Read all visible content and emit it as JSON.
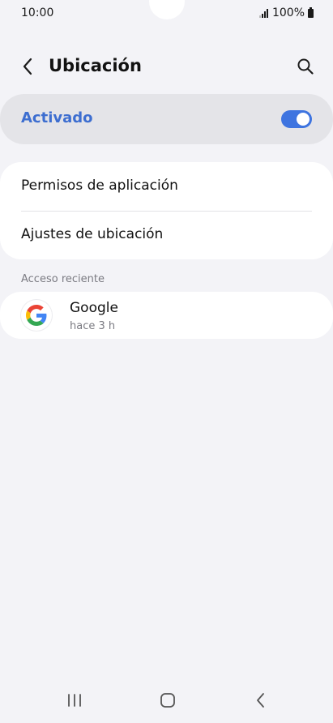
{
  "status_bar": {
    "time": "10:00",
    "battery_text": "100%"
  },
  "header": {
    "title": "Ubicación",
    "back_icon": "chevron-left-icon",
    "search_icon": "search-icon"
  },
  "master_switch": {
    "label": "Activado",
    "enabled": true,
    "accent_color": "#3d6ed0"
  },
  "settings_items": [
    {
      "label": "Permisos de aplicación"
    },
    {
      "label": "Ajustes de ubicación"
    }
  ],
  "recent_access": {
    "header": "Acceso reciente",
    "items": [
      {
        "app_name": "Google",
        "time": "hace 3 h",
        "icon": "google-icon"
      }
    ]
  },
  "nav_bar": {
    "recents_icon": "recents-icon",
    "home_icon": "home-icon",
    "back_icon": "back-nav-icon"
  }
}
